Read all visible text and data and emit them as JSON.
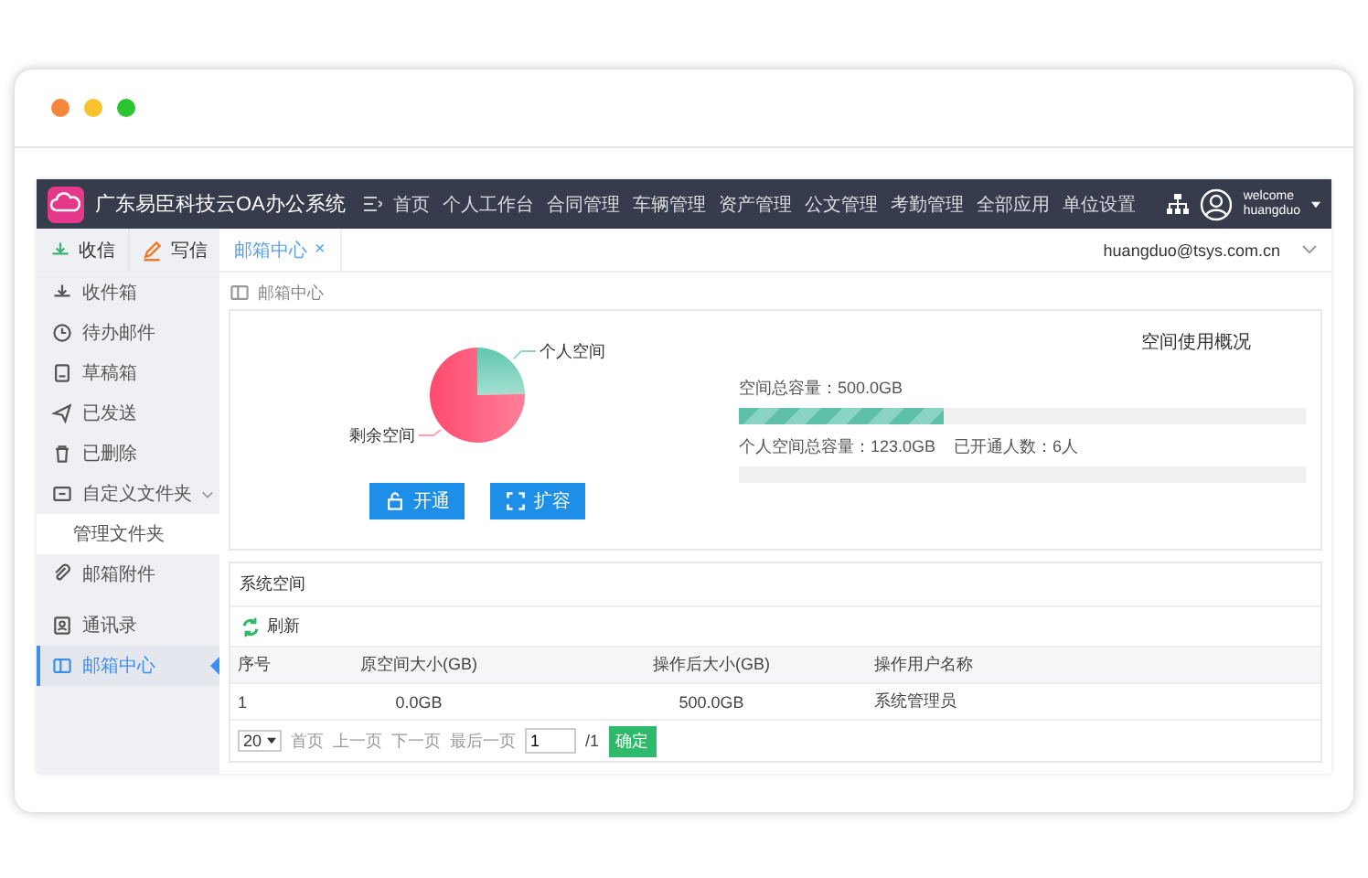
{
  "window": {
    "controls": [
      {
        "color": "#f6873b"
      },
      {
        "color": "#f9c22b"
      },
      {
        "color": "#2ac52f"
      }
    ]
  },
  "header": {
    "title": "广东易臣科技云OA办公系统",
    "nav": [
      {
        "label": "首页"
      },
      {
        "label": "个人工作台"
      },
      {
        "label": "合同管理"
      },
      {
        "label": "车辆管理"
      },
      {
        "label": "资产管理"
      },
      {
        "label": "公文管理"
      },
      {
        "label": "考勤管理"
      },
      {
        "label": "全部应用"
      },
      {
        "label": "单位设置"
      }
    ],
    "user": {
      "greeting": "welcome",
      "name": "huangduo"
    }
  },
  "toolbar": {
    "receive": "收信",
    "compose": "写信",
    "tabs": [
      {
        "label": "邮箱中心",
        "close": "×",
        "selected": true
      }
    ],
    "account": "huangduo@tsys.com.cn"
  },
  "sidebar": {
    "groups": [
      {
        "items": [
          {
            "label": "收件箱",
            "selected": false
          },
          {
            "label": "待办邮件",
            "selected": false
          },
          {
            "label": "草稿箱",
            "selected": false
          },
          {
            "label": "已发送",
            "selected": false
          },
          {
            "label": "已删除",
            "selected": false
          },
          {
            "label": "自定义文件夹",
            "selected": false,
            "expanded": true,
            "children": [
              {
                "label": "管理文件夹",
                "selected": false
              }
            ]
          },
          {
            "label": "邮箱附件",
            "selected": false
          }
        ]
      },
      {
        "items": [
          {
            "label": "通讯录",
            "selected": false
          },
          {
            "label": "邮箱中心",
            "selected": true
          }
        ]
      }
    ]
  },
  "main": {
    "breadcrumb": "邮箱中心",
    "overview": {
      "pie_labels": [
        "个人空间",
        "剩余空间"
      ],
      "buttons": [
        "开通",
        "扩容"
      ],
      "title": "空间使用概况",
      "stats": [
        {
          "texts": [
            "空间总容量：500.0GB"
          ],
          "level": 0.36
        },
        {
          "texts": [
            "个人空间总容量：123.0GB",
            "已开通人数：6人"
          ],
          "level": 0
        }
      ]
    },
    "system": {
      "title": "系统空间",
      "refresh": "刷新",
      "table": {
        "columns": [
          "序号",
          "原空间大小(GB)",
          "操作后大小(GB)",
          "操作用户名称"
        ],
        "rows": [
          [
            "1",
            "0.0GB",
            "500.0GB",
            "系统管理员"
          ]
        ]
      },
      "pagination": {
        "page_size": "20",
        "links": [
          "首页",
          "上一页",
          "下一页",
          "最后一页"
        ],
        "page": "1",
        "total": "/1",
        "go": "确定"
      }
    }
  }
}
